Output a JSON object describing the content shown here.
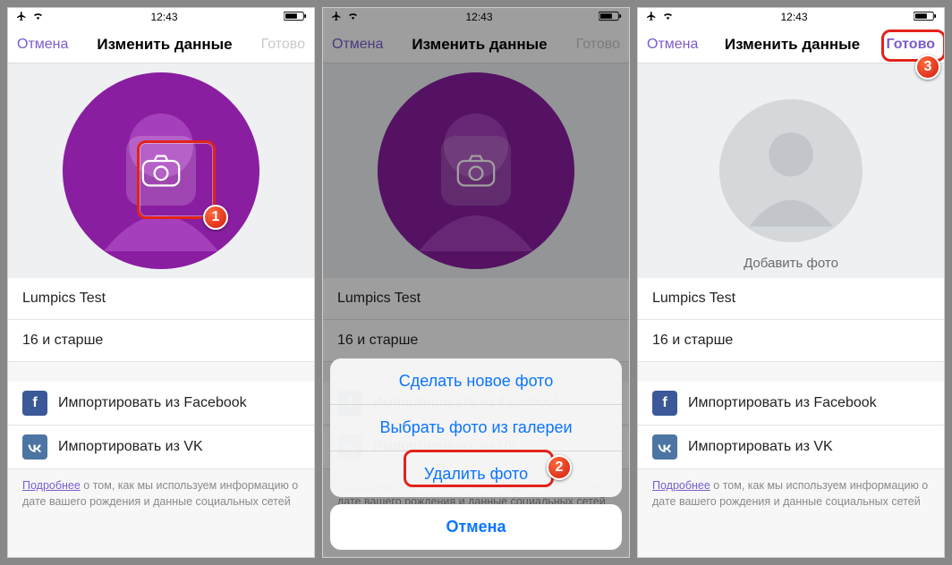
{
  "status": {
    "time": "12:43"
  },
  "nav": {
    "cancel": "Отмена",
    "title": "Изменить данные",
    "done": "Готово"
  },
  "profile": {
    "name": "Lumpics Test",
    "age": "16 и старше",
    "add_photo": "Добавить фото"
  },
  "social": {
    "facebook": "Импортировать из Facebook",
    "vk": "Импортировать из VK"
  },
  "footer": {
    "link": "Подробнее",
    "rest": " о том, как мы используем информацию о дате вашего рождения и данные социальных сетей"
  },
  "sheet": {
    "take": "Сделать новое фото",
    "choose": "Выбрать фото из галереи",
    "delete": "Удалить фото",
    "cancel": "Отмена"
  },
  "callouts": {
    "one": "1",
    "two": "2",
    "three": "3"
  }
}
